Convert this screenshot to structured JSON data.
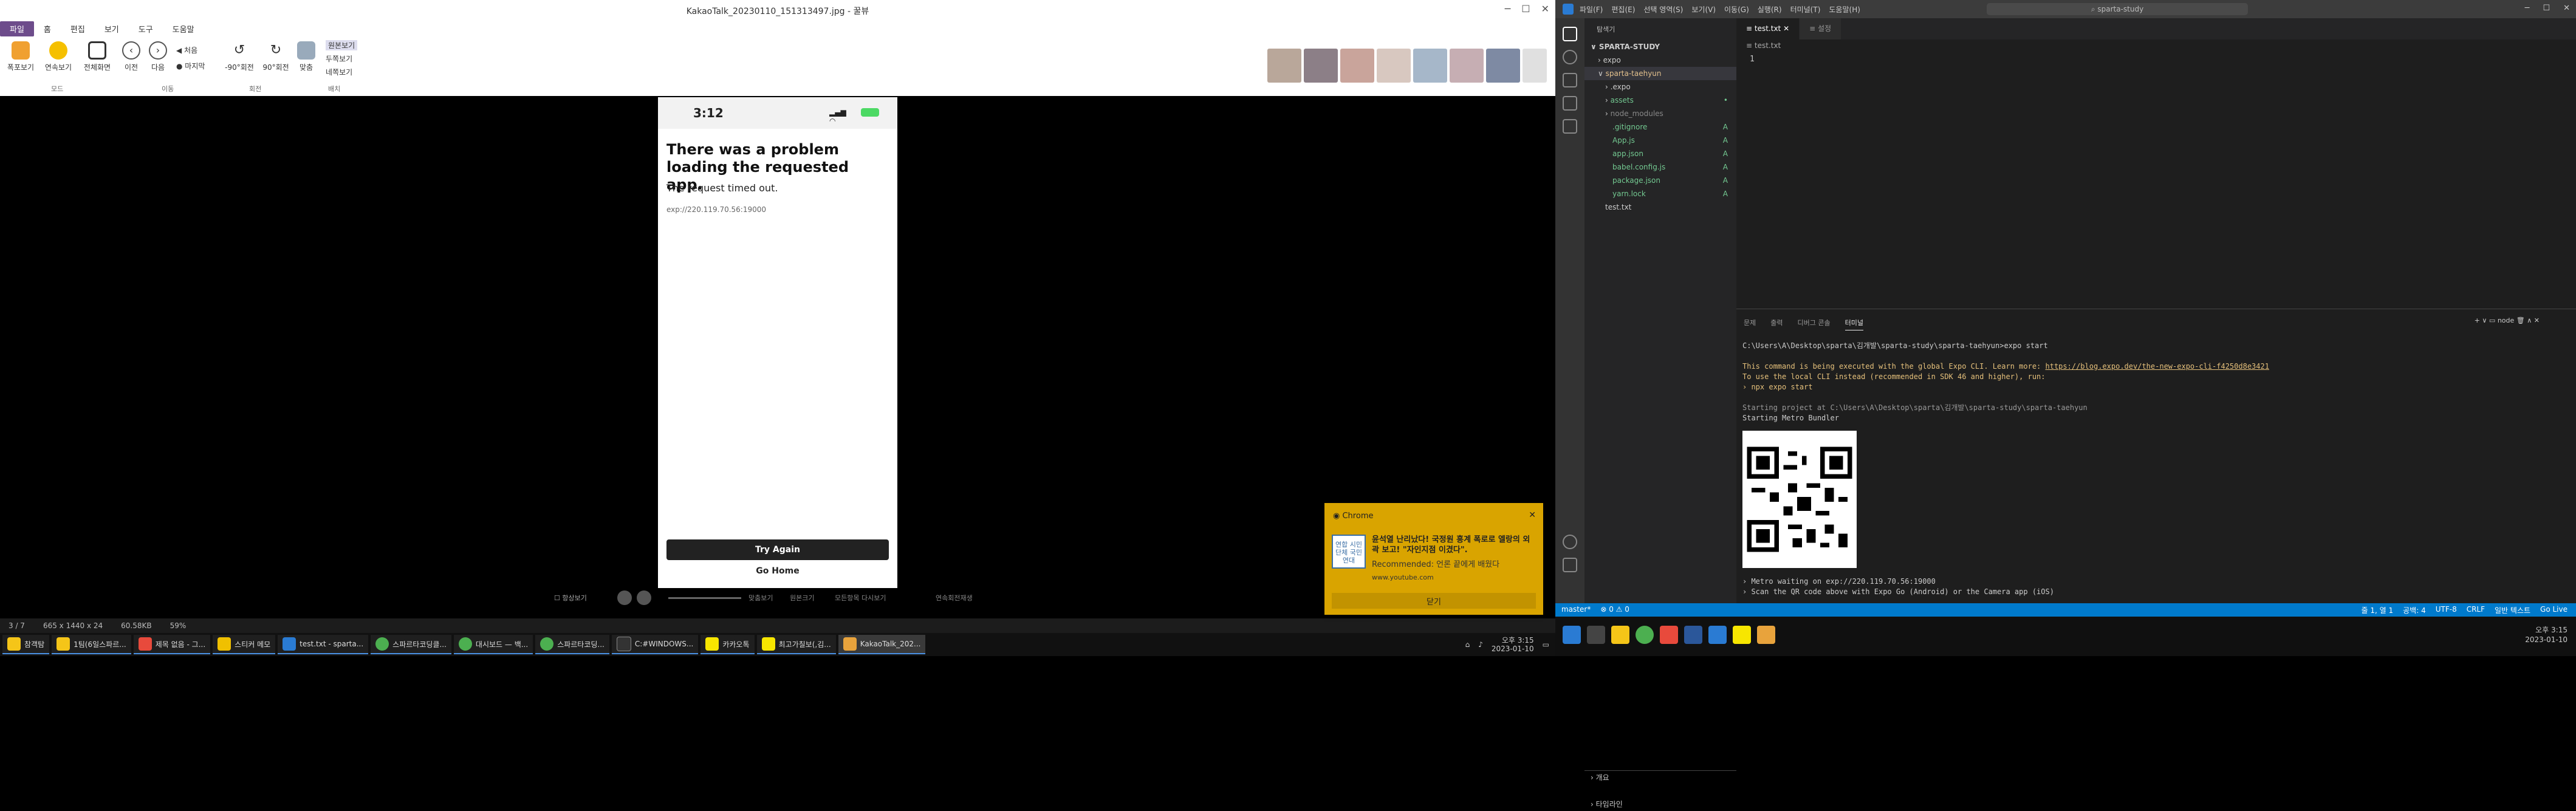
{
  "viewer": {
    "title": "KakaoTalk_20230110_151313497.jpg - 꿀뷰",
    "menu": [
      "파일",
      "홈",
      "편집",
      "보기",
      "도구",
      "도움말"
    ],
    "ribbon": {
      "buttons": [
        "폭포보기",
        "연속보기",
        "전체화면",
        "이전",
        "다음",
        "-90°회전",
        "90°회전",
        "맞춤"
      ],
      "nav_links": [
        "처음",
        "마지막"
      ],
      "view_options": [
        "원본보기",
        "두쪽보기",
        "네쪽보기"
      ],
      "groups": [
        "모드",
        "이동",
        "회전",
        "배치"
      ]
    },
    "status": [
      "3 / 7",
      "665 x 1440 x 24",
      "60.58KB",
      "59%"
    ],
    "bottom_controls": [
      "항상보기",
      "맞춤보기",
      "원본크기",
      "모든항목 다시보기",
      "연속회전재생"
    ]
  },
  "phone": {
    "time": "3:12",
    "heading": "There was a problem loading the requested app.",
    "message": "The request timed out.",
    "url": "exp://220.119.70.56:19000",
    "try_again": "Try Again",
    "go_home": "Go Home"
  },
  "notification": {
    "source_app": "Chrome",
    "logo_text": "연합 시민단체 국민연대",
    "title": "윤석열 난리났다! 국정원 흥계 폭로로 엘랑의 외곽 보고! \"자인지점 이겼다\".",
    "subtitle": "Recommended: 언론 끝에게 배웠다",
    "url": "www.youtube.com",
    "close_label": "닫기"
  },
  "taskbar_left": {
    "items": [
      "참객탐",
      "1팀(6일스파르...",
      "제목 없음 - 그...",
      "스티커 메모",
      "test.txt - sparta...",
      "스파르타코딩클...",
      "대시보드 — 백...",
      "스파르타코딩...",
      "C:#WINDOWS...",
      "카카오톡",
      "최고가칠보(,김...",
      "KakaoTalk_202..."
    ],
    "time": "오후 3:15",
    "date": "2023-01-10"
  },
  "vscode": {
    "menu": [
      "파일(F)",
      "편집(E)",
      "선택 영역(S)",
      "보기(V)",
      "이동(G)",
      "실행(R)",
      "터미널(T)",
      "도움말(H)"
    ],
    "command_center": "sparta-study",
    "explorer_header": "탐색기",
    "workspace": "SPARTA-STUDY",
    "tree": [
      {
        "name": "expo",
        "type": "folder",
        "indent": 1
      },
      {
        "name": "sparta-taehyun",
        "type": "folder-open",
        "indent": 1
      },
      {
        "name": ".expo",
        "type": "folder",
        "indent": 2
      },
      {
        "name": "assets",
        "type": "folder",
        "indent": 2,
        "mark": "•"
      },
      {
        "name": "node_modules",
        "type": "folder",
        "indent": 2
      },
      {
        "name": ".gitignore",
        "type": "file",
        "indent": 2,
        "mark": "A"
      },
      {
        "name": "App.js",
        "type": "file",
        "indent": 2,
        "mark": "A"
      },
      {
        "name": "app.json",
        "type": "file",
        "indent": 2,
        "mark": "A"
      },
      {
        "name": "babel.config.js",
        "type": "file",
        "indent": 2,
        "mark": "A"
      },
      {
        "name": "package.json",
        "type": "file",
        "indent": 2,
        "mark": "A"
      },
      {
        "name": "yarn.lock",
        "type": "file",
        "indent": 2,
        "mark": "A"
      },
      {
        "name": "test.txt",
        "type": "file",
        "indent": 1
      }
    ],
    "outline": [
      "개요",
      "타임라인"
    ],
    "tabs": [
      "test.txt",
      "설정"
    ],
    "breadcrumb": "test.txt",
    "line_number": "1",
    "panel_tabs": [
      "문제",
      "출력",
      "디버그 콘솔",
      "터미널"
    ],
    "terminal_shell": "node",
    "terminal": {
      "prompt": "C:\\Users\\A\\Desktop\\sparta\\김개발\\sparta-study\\sparta-taehyun>expo start",
      "warn1": "This command is being executed with the global Expo CLI. Learn more: ",
      "warn_link": "https://blog.expo.dev/the-new-expo-cli-f4250d8e3421",
      "warn2": "To use the local CLI instead (recommended in SDK 46 and higher), run:",
      "warn3": "› npx expo start",
      "start1": "Starting project at C:\\Users\\A\\Desktop\\sparta\\김개발\\sparta-study\\sparta-taehyun",
      "start2": "Starting Metro Bundler",
      "metro": "› Metro waiting on exp://220.119.70.56:19000",
      "scan": "› Scan the QR code above with Expo Go (Android) or the Camera app (iOS)"
    },
    "status_left": [
      "master*",
      "⊗ 0 ⚠ 0"
    ],
    "status_right": [
      "줄 1, 열 1",
      "공백: 4",
      "UTF-8",
      "CRLF",
      "일반 텍스트",
      "Go Live"
    ]
  },
  "taskbar_right": {
    "time": "오후 3:15",
    "date": "2023-01-10"
  }
}
